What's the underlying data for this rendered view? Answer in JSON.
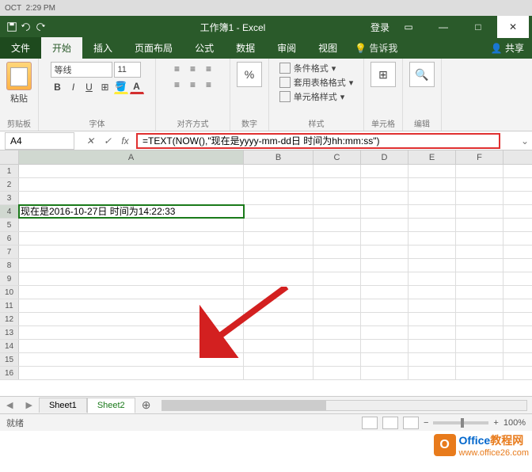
{
  "menubar": {
    "date": "OCT",
    "time": "2:29 PM"
  },
  "titlebar": {
    "title": "工作簿1 - Excel",
    "login": "登录"
  },
  "tabs": {
    "file": "文件",
    "home": "开始",
    "insert": "插入",
    "layout": "页面布局",
    "formula": "公式",
    "data": "数据",
    "review": "审阅",
    "view": "视图",
    "tellme": "告诉我",
    "share": "共享"
  },
  "ribbon": {
    "paste": "粘贴",
    "clipboard": "剪贴板",
    "font_name": "等线",
    "font_size": "11",
    "font": "字体",
    "align": "对齐方式",
    "number": "数字",
    "cond_format": "条件格式",
    "table_format": "套用表格格式",
    "cell_style": "单元格样式",
    "styles": "样式",
    "cells": "单元格",
    "editing": "编辑"
  },
  "namebox": "A4",
  "formula": "=TEXT(NOW(),\"现在是yyyy-mm-dd日 时间为hh:mm:ss\")",
  "columns": [
    "A",
    "B",
    "C",
    "D",
    "E",
    "F"
  ],
  "row_count": 16,
  "selected_row": 4,
  "cell_a4": "现在是2016-10-27日 时间为14:22:33",
  "sheets": {
    "sheet1": "Sheet1",
    "sheet2": "Sheet2"
  },
  "status": {
    "ready": "就绪",
    "zoom": "100%"
  },
  "watermark": {
    "brand": "Office",
    "suffix": "教程网",
    "url": "www.office26.com"
  }
}
